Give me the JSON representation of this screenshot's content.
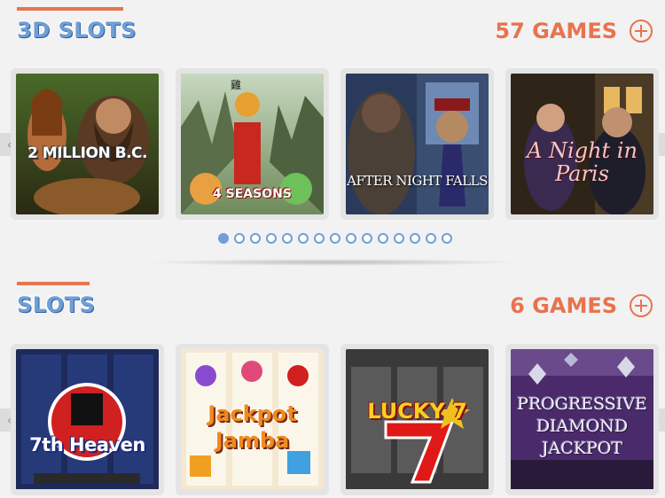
{
  "sections": [
    {
      "title": "3D SLOTS",
      "count": "57 GAMES",
      "games": [
        {
          "title": "2 MILLION B.C."
        },
        {
          "title": "4 SEASONS",
          "glyph": "雞"
        },
        {
          "title": "AFTER NIGHT FALLS"
        },
        {
          "title": "A Night in Paris"
        }
      ],
      "pagination": {
        "pages": 15,
        "active": 1
      }
    },
    {
      "title": "SLOTS",
      "count": "6 GAMES",
      "games": [
        {
          "title": "7th Heaven"
        },
        {
          "title": "Jackpot Jamba"
        },
        {
          "title": "LUCKY 7"
        },
        {
          "title": "PROGRESSIVE DIAMOND JACKPOT"
        }
      ]
    }
  ],
  "icons": {
    "prev": "chevron-left-icon",
    "next": "chevron-right-icon",
    "more": "plus-circle-icon"
  },
  "colors": {
    "accent": "#e8734f",
    "title_blue": "#6e9fd6",
    "background": "#f2f2f2"
  }
}
